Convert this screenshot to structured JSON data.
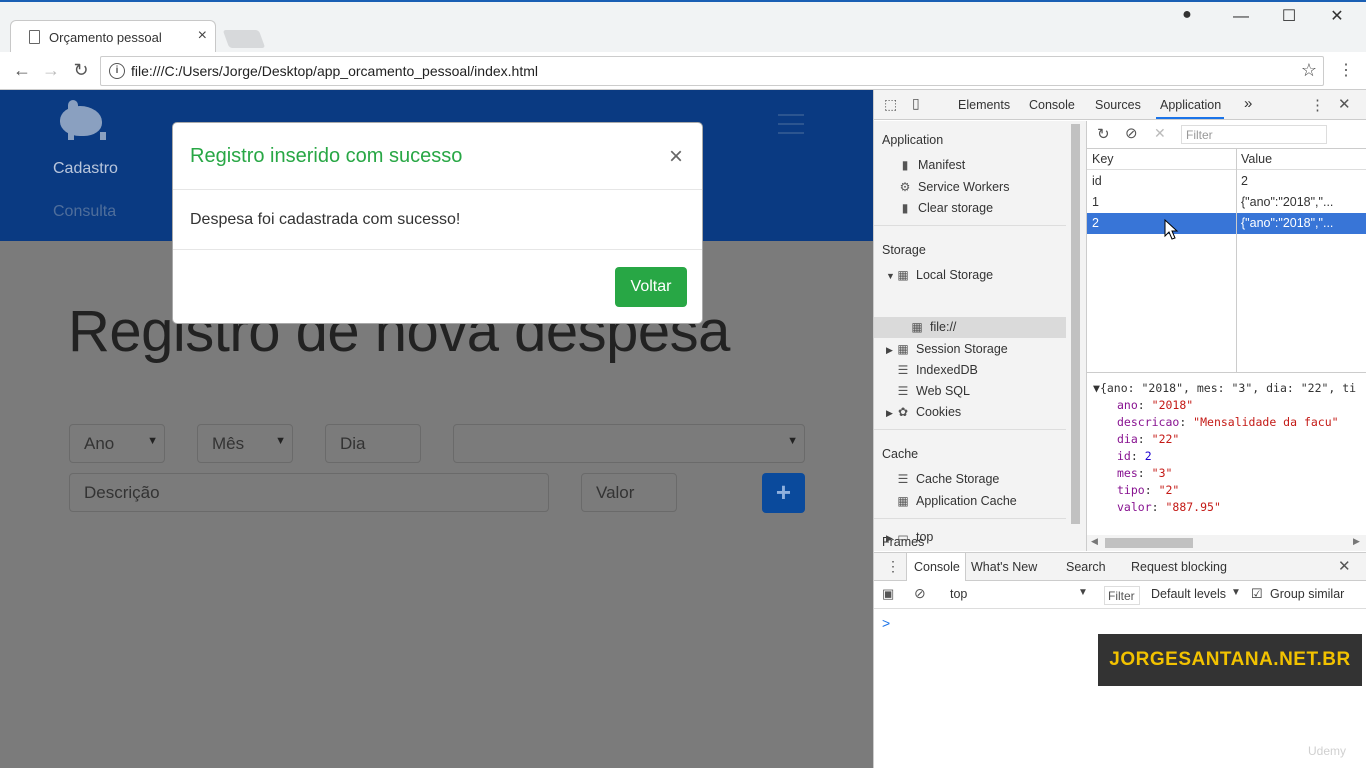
{
  "browser": {
    "tab_title": "Orçamento pessoal",
    "tab_close": "×",
    "url": "file:///C:/Users/Jorge/Desktop/app_orcamento_pessoal/index.html"
  },
  "page": {
    "nav": {
      "cadastro": "Cadastro",
      "consulta": "Consulta"
    },
    "heading": "Registro de nova despesa",
    "form": {
      "ano": "Ano",
      "mes": "Mês",
      "dia": "Dia",
      "tipo": "",
      "descricao": "Descrição",
      "valor": "Valor",
      "add": "+"
    }
  },
  "modal": {
    "title": "Registro inserido com sucesso",
    "close": "×",
    "body": "Despesa foi cadastrada com sucesso!",
    "button": "Voltar"
  },
  "devtools": {
    "tabs": [
      "Elements",
      "Console",
      "Sources",
      "Application"
    ],
    "more": "»",
    "sidebar": {
      "application_header": "Application",
      "manifest": "Manifest",
      "service_workers": "Service Workers",
      "clear_storage": "Clear storage",
      "storage_header": "Storage",
      "local_storage": "Local Storage",
      "file": "file://",
      "session_storage": "Session Storage",
      "indexeddb": "IndexedDB",
      "websql": "Web SQL",
      "cookies": "Cookies",
      "cache_header": "Cache",
      "cache_storage": "Cache Storage",
      "application_cache": "Application Cache",
      "frames_header": "Frames",
      "top": "top"
    },
    "filter_placeholder": "Filter",
    "table": {
      "key_header": "Key",
      "value_header": "Value",
      "rows": [
        {
          "key": "id",
          "value": "2"
        },
        {
          "key": "1",
          "value": "{\"ano\":\"2018\",\"..."
        },
        {
          "key": "2",
          "value": "{\"ano\":\"2018\",\"..."
        }
      ]
    },
    "preview": {
      "summary": "{ano: \"2018\", mes: \"3\", dia: \"22\", ti",
      "fields": [
        {
          "k": "ano",
          "v": "\"2018\""
        },
        {
          "k": "descricao",
          "v": "\"Mensalidade da facu\""
        },
        {
          "k": "dia",
          "v": "\"22\""
        },
        {
          "k": "id",
          "v": "2"
        },
        {
          "k": "mes",
          "v": "\"3\""
        },
        {
          "k": "tipo",
          "v": "\"2\""
        },
        {
          "k": "valor",
          "v": "\"887.95\""
        }
      ]
    },
    "drawer": {
      "tabs": [
        "Console",
        "What's New",
        "Search",
        "Request blocking"
      ],
      "context": "top",
      "filter": "Filter",
      "levels": "Default levels",
      "group_similar": "Group similar",
      "prompt": ">"
    }
  },
  "overlay": {
    "watermark": "JORGESANTANA.NET.BR",
    "udemy": "Udemy"
  }
}
